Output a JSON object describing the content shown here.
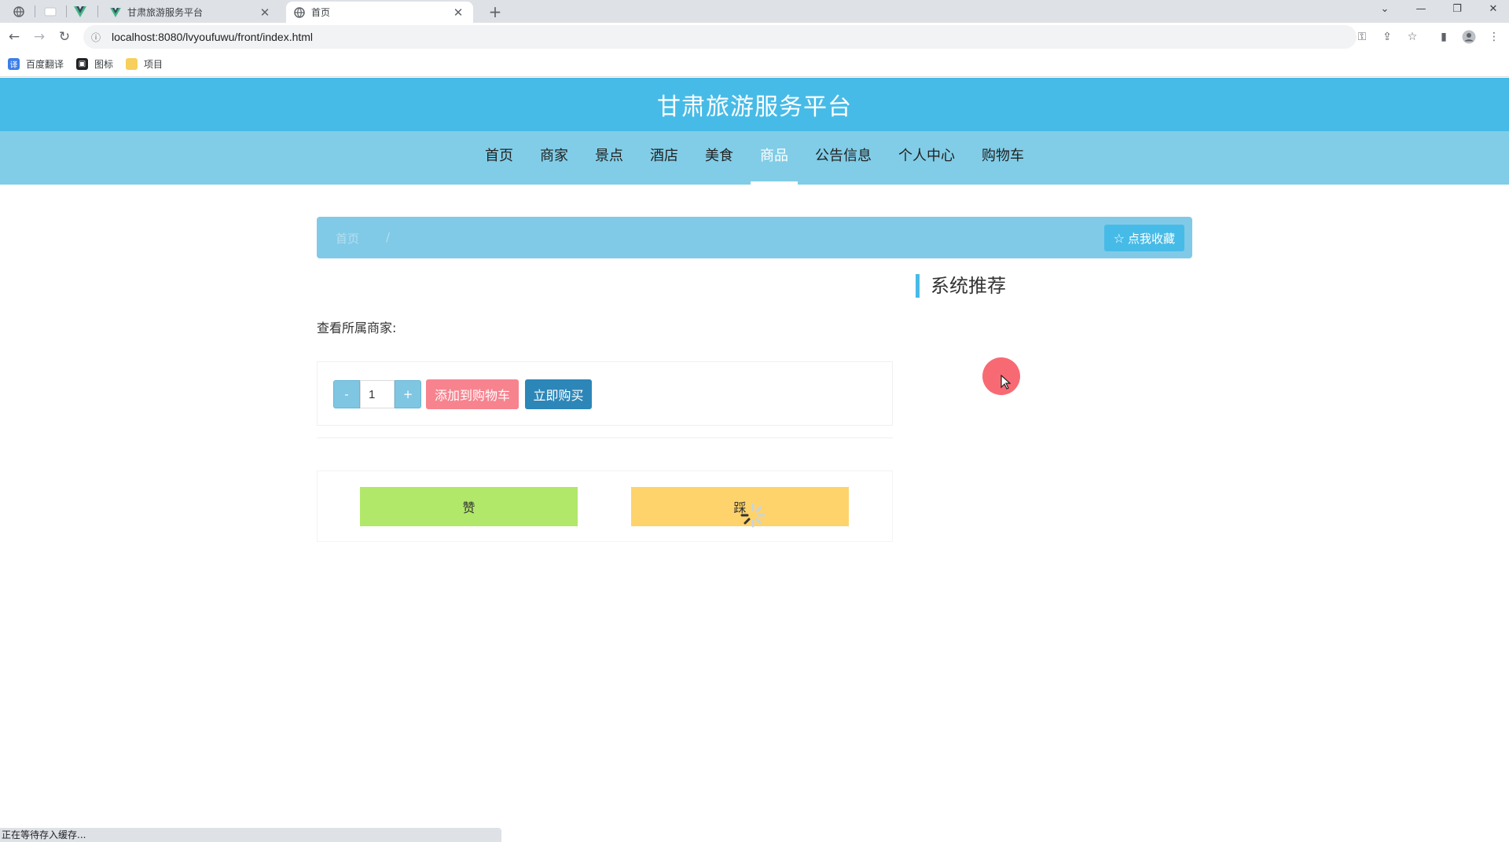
{
  "browser": {
    "tabs": [
      {
        "title": "甘肃旅游服务平台",
        "active": false
      },
      {
        "title": "首页",
        "active": true
      }
    ],
    "url": "localhost:8080/lvyoufuwu/front/index.html",
    "bookmarks": [
      "百度翻译",
      "图标",
      "项目"
    ],
    "status_text": "正在等待存入缓存..."
  },
  "site": {
    "title": "甘肃旅游服务平台",
    "nav": [
      "首页",
      "商家",
      "景点",
      "酒店",
      "美食",
      "商品",
      "公告信息",
      "个人中心",
      "购物车"
    ],
    "active_nav": "商品"
  },
  "breadcrumb": {
    "home": "首页",
    "separator": "/",
    "favorite_button": "点我收藏"
  },
  "product": {
    "seller_label": "查看所属商家:",
    "qty_minus": "-",
    "qty_plus": "+",
    "quantity": "1",
    "add_to_cart": "添加到购物车",
    "buy_now": "立即购买",
    "like": "赞",
    "dislike": "踩"
  },
  "sidebar": {
    "recommend_title": "系统推荐"
  },
  "colors": {
    "header": "#47bbe7",
    "nav": "#81cde7",
    "add_to_cart": "#f7838f",
    "buy_now": "#2d86b8",
    "like": "#b1e86a",
    "dislike": "#ffd36b"
  }
}
